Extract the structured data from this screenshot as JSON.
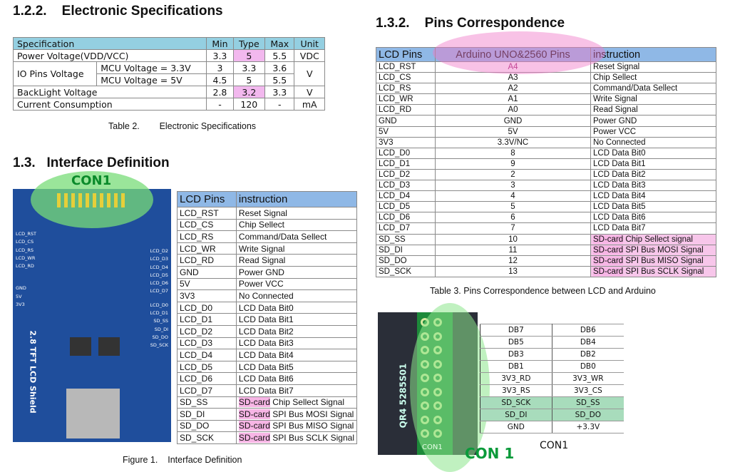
{
  "left": {
    "heading_spec": "1.2.2.    Electronic Specifications",
    "spec_table": {
      "headers": [
        "Specification",
        "Min",
        "Type",
        "Max",
        "Unit"
      ],
      "power": {
        "label": "Power Voltage(VDD/VCC)",
        "min": "3.3",
        "type": "5",
        "max": "5.5",
        "unit": "VDC"
      },
      "io": {
        "label": "IO Pins Voltage",
        "unit": "V",
        "sub": [
          {
            "label": "MCU Voltage = 3.3V",
            "min": "3",
            "type": "3.3",
            "max": "3.6"
          },
          {
            "label": "MCU Voltage = 5V",
            "min": "4.5",
            "type": "5",
            "max": "5.5"
          }
        ]
      },
      "backlight": {
        "label": "BackLight Voltage",
        "min": "2.8",
        "type": "3.2",
        "max": "3.3",
        "unit": "V"
      },
      "current": {
        "label": "Current Consumption",
        "min": "-",
        "type": "120",
        "max": "-",
        "unit": "mA"
      }
    },
    "spec_caption": "Table 2.        Electronic Specifications",
    "heading_interface": "1.3.   Interface Definition",
    "board": {
      "con_label": "CON1",
      "title": "2.8 TFT LCD Shield",
      "left_pins": [
        "LCD_RST",
        "LCD_CS",
        "LCD_RS",
        "LCD_WR",
        "LCD_RD",
        "GND",
        "5V",
        "3V3"
      ],
      "right_pins": [
        "LCD_D2",
        "LCD_D3",
        "LCD_D4",
        "LCD_D5",
        "LCD_D6",
        "LCD_D7",
        "LCD_D0",
        "LCD_D1",
        "SD_SS",
        "SD_DI",
        "SD_DO",
        "SD_SCK"
      ]
    },
    "pin_table": {
      "headers": [
        "LCD Pins",
        "instruction"
      ],
      "rows": [
        [
          "LCD_RST",
          "Reset Signal"
        ],
        [
          "LCD_CS",
          "Chip Sellect"
        ],
        [
          "LCD_RS",
          "Command/Data Sellect"
        ],
        [
          "LCD_WR",
          "Write Signal"
        ],
        [
          "LCD_RD",
          "Read Signal"
        ],
        [
          "GND",
          "Power GND"
        ],
        [
          "5V",
          "Power VCC"
        ],
        [
          "3V3",
          "No Connected"
        ],
        [
          "LCD_D0",
          "LCD Data Bit0"
        ],
        [
          "LCD_D1",
          "LCD Data Bit1"
        ],
        [
          "LCD_D2",
          "LCD Data Bit2"
        ],
        [
          "LCD_D3",
          "LCD Data Bit3"
        ],
        [
          "LCD_D4",
          "LCD Data Bit4"
        ],
        [
          "LCD_D5",
          "LCD Data Bit5"
        ],
        [
          "LCD_D6",
          "LCD Data Bit6"
        ],
        [
          "LCD_D7",
          "LCD Data Bit7"
        ],
        [
          "SD_SS",
          "SD-card| Chip Sellect Signal"
        ],
        [
          "SD_DI",
          "SD-card| SPI Bus MOSI Signal"
        ],
        [
          "SD_DO",
          "SD-card| SPI Bus MISO Signal"
        ],
        [
          "SD_SCK",
          "SD-card| SPI Bus SCLK Signal"
        ]
      ]
    },
    "figure_caption": "Figure 1.    Interface Definition"
  },
  "right": {
    "heading": "1.3.2.    Pins Correspondence",
    "table": {
      "headers": [
        "LCD Pins",
        "Arduino UNO&2560 Pins",
        "instruction"
      ],
      "rows": [
        [
          "LCD_RST",
          "A4",
          "Reset Signal"
        ],
        [
          "LCD_CS",
          "A3",
          "Chip Sellect"
        ],
        [
          "LCD_RS",
          "A2",
          "Command/Data Sellect"
        ],
        [
          "LCD_WR",
          "A1",
          "Write Signal"
        ],
        [
          "LCD_RD",
          "A0",
          "Read Signal"
        ],
        [
          "GND",
          "GND",
          "Power GND"
        ],
        [
          "5V",
          "5V",
          "Power VCC"
        ],
        [
          "3V3",
          "3.3V/NC",
          "No Connected"
        ],
        [
          "LCD_D0",
          "8",
          "LCD Data Bit0"
        ],
        [
          "LCD_D1",
          "9",
          "LCD Data Bit1"
        ],
        [
          "LCD_D2",
          "2",
          "LCD Data Bit2"
        ],
        [
          "LCD_D3",
          "3",
          "LCD Data Bit3"
        ],
        [
          "LCD_D4",
          "4",
          "LCD Data Bit4"
        ],
        [
          "LCD_D5",
          "5",
          "LCD Data Bit5"
        ],
        [
          "LCD_D6",
          "6",
          "LCD Data Bit6"
        ],
        [
          "LCD_D7",
          "7",
          "LCD Data Bit7"
        ],
        [
          "SD_SS",
          "10",
          "SD-card| Chip Sellect signal"
        ],
        [
          "SD_DI",
          "11",
          "SD-card| SPI Bus MOSI Signal"
        ],
        [
          "SD_DO",
          "12",
          "SD-card| SPI Bus MISO Signal"
        ],
        [
          "SD_SCK",
          "13",
          "SD-card| SPI Bus SCLK Signal"
        ]
      ]
    },
    "caption": "Table 3. Pins Correspondence between LCD and Arduino",
    "con": {
      "board_text": "QR4  5285S01",
      "board_label": "CON1",
      "big_label": "CON 1",
      "title": "CON1",
      "rows": [
        [
          "DB7",
          "DB6"
        ],
        [
          "DB5",
          "DB4"
        ],
        [
          "DB3",
          "DB2"
        ],
        [
          "DB1",
          "DB0"
        ],
        [
          "3V3_RD",
          "3V3_WR"
        ],
        [
          "3V3_RS",
          "3V3_CS"
        ],
        [
          "SD_SCK",
          "SD_SS"
        ],
        [
          "SD_DI",
          "SD_DO"
        ],
        [
          "GND",
          "+3.3V"
        ]
      ]
    }
  }
}
